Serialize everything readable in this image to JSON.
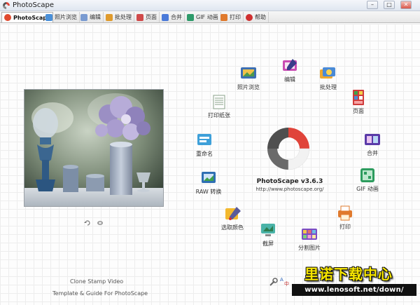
{
  "window": {
    "title": "PhotoScape",
    "minimize": "–",
    "maximize": "□",
    "close": "✕"
  },
  "tabs": [
    {
      "label": "PhotoScape",
      "icon": "photoscape-logo-icon",
      "color": "#e04a2f"
    },
    {
      "label": "照片浏览",
      "icon": "viewer-icon",
      "color": "#4a90d9"
    },
    {
      "label": "编辑",
      "icon": "editor-icon",
      "color": "#7a9bd1"
    },
    {
      "label": "批处理",
      "icon": "batch-icon",
      "color": "#e09b2d"
    },
    {
      "label": "页面",
      "icon": "page-icon",
      "color": "#d04a4a"
    },
    {
      "label": "合并",
      "icon": "combine-icon",
      "color": "#4a7ad9"
    },
    {
      "label": "GIF 动画",
      "icon": "gif-icon",
      "color": "#2e9a6a"
    },
    {
      "label": "打印",
      "icon": "print-icon",
      "color": "#e07a2d"
    },
    {
      "label": "帮助",
      "icon": "help-icon",
      "color": "#d03030"
    }
  ],
  "logo": {
    "version": "PhotoScape v3.6.3",
    "url": "http://www.photoscape.org/"
  },
  "menu": {
    "viewer": "照片浏览",
    "editor": "编辑",
    "batch": "批处理",
    "page": "页面",
    "combine": "合并",
    "gif": "GIF 动画",
    "print": "打印",
    "splitter": "分割图片",
    "screen_capture": "截屏",
    "color_picker": "选取颜色",
    "raw": "RAW 转换",
    "rename": "重命名",
    "print_paper": "打印纸张"
  },
  "bottom": {
    "line1": "Clone Stamp Video",
    "line2": "Template & Guide For PhotoScape"
  },
  "watermark": {
    "title": "里诺下载中心",
    "url": "www.lenosoft.net/down/"
  },
  "colors": {
    "logo_red": "#e0443a",
    "logo_gray": "#4f4f4f",
    "watermark_yellow": "#f7e600"
  }
}
